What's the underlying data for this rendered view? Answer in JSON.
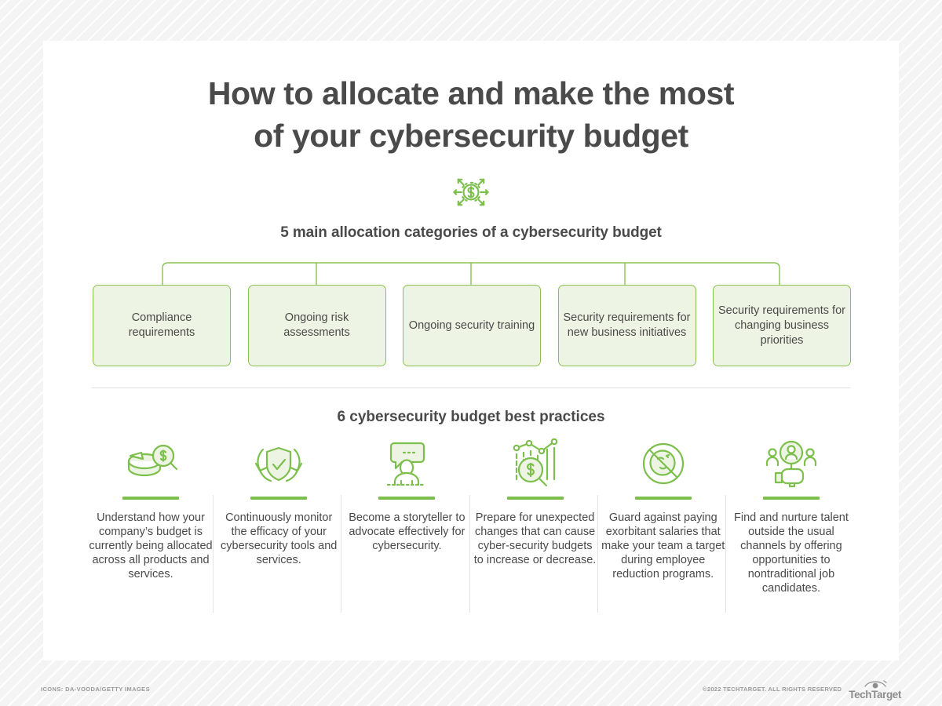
{
  "title": {
    "line1": "How to allocate and make the most",
    "line2": "of your cybersecurity budget"
  },
  "hero_icon": "budget-allocation-icon",
  "categories_section": {
    "heading": "5 main allocation categories of a cybersecurity budget",
    "boxes": [
      {
        "label": "Compliance requirements",
        "icon": "category-box"
      },
      {
        "label": "Ongoing risk assessments",
        "icon": "category-box"
      },
      {
        "label": "Ongoing security training",
        "icon": "category-box"
      },
      {
        "label": "Security requirements for new business initiatives",
        "icon": "category-box"
      },
      {
        "label": "Security requirements for changing business priorities",
        "icon": "category-box"
      }
    ]
  },
  "practices_section": {
    "heading": "6 cybersecurity budget best practices",
    "items": [
      {
        "icon": "pie-chart-magnifier-dollar-icon",
        "text": "Understand how your company’s budget is currently being allocated across all products and services."
      },
      {
        "icon": "shield-check-refresh-icon",
        "text": "Continuously monitor the efficacy of your cybersecurity tools and services."
      },
      {
        "icon": "person-speech-bubble-icon",
        "text": "Become a storyteller to advocate effectively for cybersecurity."
      },
      {
        "icon": "line-chart-magnifier-dollar-icon",
        "text": "Prepare for unexpected changes that can cause cyber-security budgets to increase or decrease."
      },
      {
        "icon": "no-money-prohibition-icon",
        "text": "Guard against paying exorbitant salaries that make your team a target during employee reduction programs."
      },
      {
        "icon": "talent-search-people-icon",
        "text": "Find and nurture talent outside the usual channels by offering opportunities to nontraditional job candidates."
      }
    ]
  },
  "footer": {
    "credit": "ICONS: DA-VOODA/GETTY IMAGES",
    "copyright": "©2022 TECHTARGET. ALL RIGHTS RESERVED",
    "logo_text": "TechTarget",
    "logo_icon": "techtarget-eye-logo"
  },
  "colors": {
    "accent_green": "#7cbf4d",
    "box_border": "#8cc152",
    "box_fill": "#eef4e3",
    "text_dark": "#4a4a4a",
    "divider": "#dcdcdc",
    "footer_gray": "#9a9a9a"
  }
}
